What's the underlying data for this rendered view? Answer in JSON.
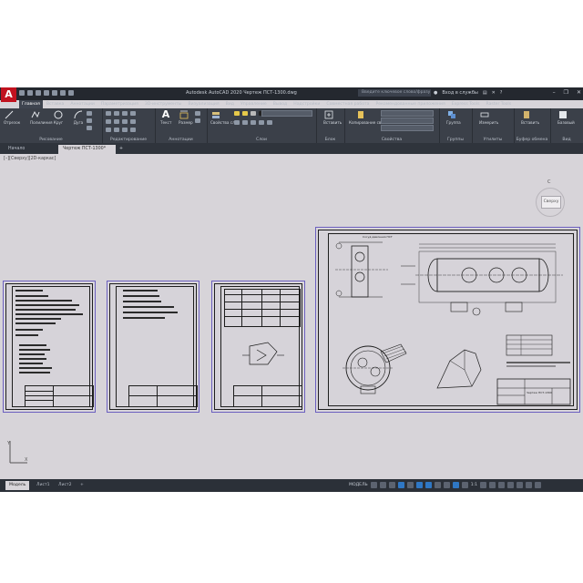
{
  "app": {
    "title": "Autodesk AutoCAD 2020   Чертеж ПСТ-1300.dwg",
    "logo_letter": "A",
    "search_placeholder": "Введите ключевое слово/фразу",
    "user": "Вход в службы",
    "brand_color": "#c1121f"
  },
  "ribbon": {
    "tabs": [
      "Главная",
      "Вставка",
      "Аннотации",
      "Параметризация",
      "3D-инструменты",
      "Визуализация",
      "Вид",
      "Управление",
      "Вывод",
      "Надстройки",
      "Совместная работа",
      "Рекомендованные приложения",
      "Express Tools",
      "Raster Tools"
    ],
    "active_tab": "Главная",
    "draw_tools": [
      "Отрезок",
      "Полилиния",
      "Круг",
      "Дуга"
    ],
    "annotation_tools": [
      "Текст",
      "Размер"
    ],
    "block_tools": [
      "Свойства слоя"
    ],
    "block_insert": "Вставить",
    "props_match": "Копирование свойств",
    "group_tool": "Группа",
    "measure_tool": "Измерить",
    "paste_tool": "Вставить",
    "base_tool": "Базовый",
    "bylayer": "ПоСлою",
    "panels": {
      "draw": "Рисование",
      "modify": "Редактирование",
      "annotation": "Аннотации",
      "layers": "Слои",
      "block": "Блок",
      "properties": "Свойства",
      "groups": "Группы",
      "utilities": "Утилиты",
      "clipboard": "Буфер обмена",
      "view": "Вид"
    }
  },
  "doc_tabs": {
    "start": "Начало",
    "drawing": "Чертеж ПСТ-1300*",
    "add": "+"
  },
  "viewport": {
    "label": "[–][Сверху][2D-каркас]",
    "viewcube_face": "Сверху",
    "compass_n": "С"
  },
  "layout_tabs": [
    "Модель",
    "Лист1",
    "Лист2",
    "+"
  ],
  "active_layout": "Модель",
  "statusbar": {
    "model": "МОДЕЛЬ",
    "scale": "1:1"
  },
  "sheets": {
    "sheet4_title": "Сосуд давления ПСТ",
    "stamp_text": "Чертеж ПСТ-1300"
  }
}
